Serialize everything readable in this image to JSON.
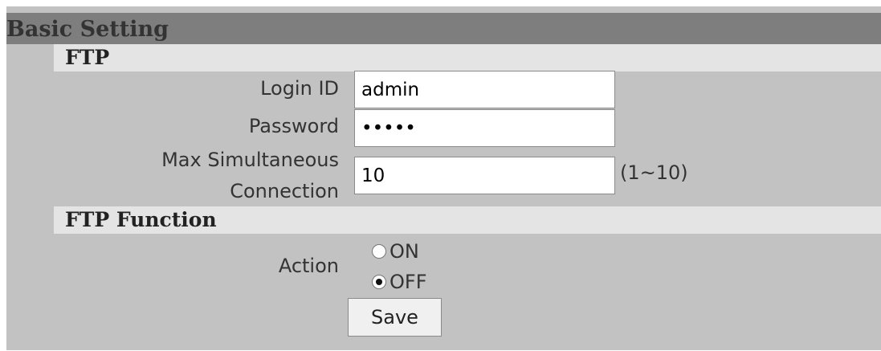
{
  "section": {
    "title": "Basic Setting"
  },
  "ftp": {
    "title": "FTP",
    "login_id_label": "Login ID",
    "login_id_value": "admin",
    "password_label": "Password",
    "password_value": "•••••",
    "max_conn_label_line1": "Max Simultaneous",
    "max_conn_label_line2": "Connection",
    "max_conn_value": "10",
    "max_conn_hint": "(1~10)"
  },
  "ftp_function": {
    "title": "FTP Function",
    "action_label": "Action",
    "options": [
      {
        "label": "ON",
        "selected": false
      },
      {
        "label": "OFF",
        "selected": true
      }
    ],
    "save_label": "Save"
  },
  "colors": {
    "panel_bg": "#c2c2c2",
    "section_header_bg": "#7e7e7e",
    "sub_header_bg": "#e4e4e4"
  }
}
